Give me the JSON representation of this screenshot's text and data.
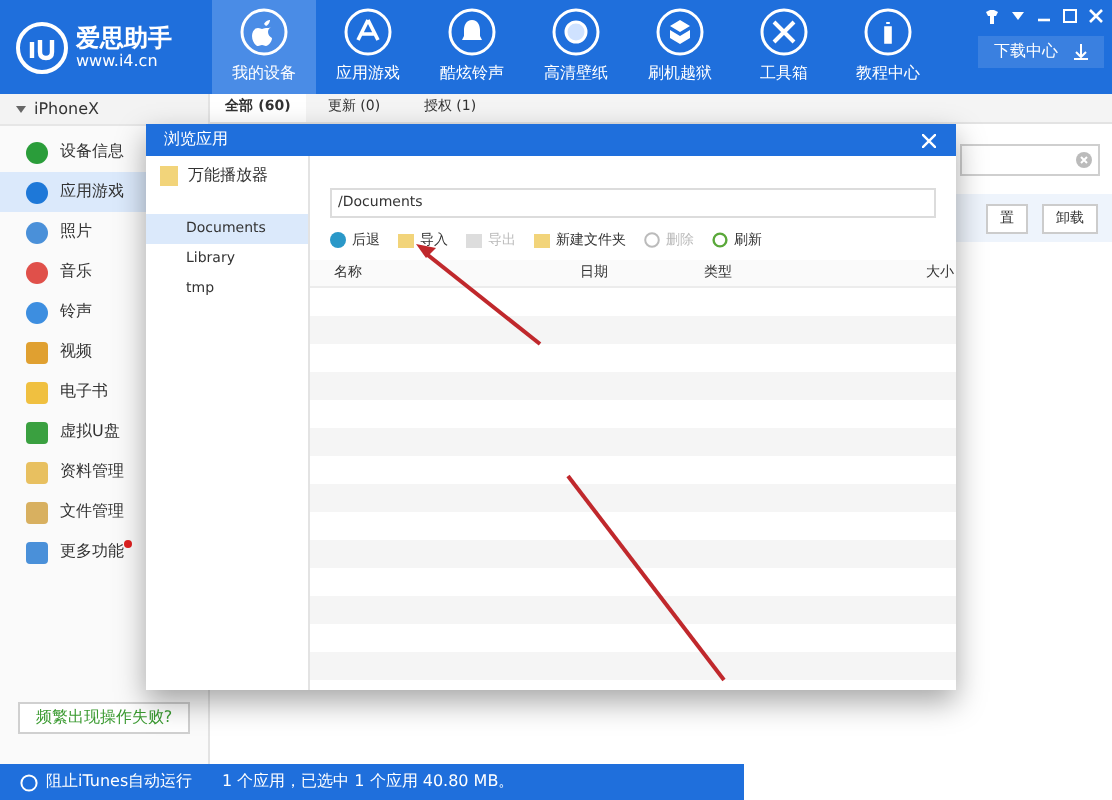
{
  "header": {
    "brand": "爱思助手",
    "url": "www.i4.cn",
    "download_button": "下载中心",
    "nav": [
      {
        "label": "我的设备",
        "selected": true
      },
      {
        "label": "应用游戏",
        "selected": false
      },
      {
        "label": "酷炫铃声",
        "selected": false
      },
      {
        "label": "高清壁纸",
        "selected": false
      },
      {
        "label": "刷机越狱",
        "selected": false
      },
      {
        "label": "工具箱",
        "selected": false
      },
      {
        "label": "教程中心",
        "selected": false
      }
    ]
  },
  "sidebar": {
    "device": "iPhoneX",
    "expanded": true,
    "items": [
      {
        "label": "设备信息",
        "selected": false,
        "badge": false
      },
      {
        "label": "应用游戏",
        "selected": true,
        "badge": false
      },
      {
        "label": "照片",
        "selected": false,
        "badge": false
      },
      {
        "label": "音乐",
        "selected": false,
        "badge": false
      },
      {
        "label": "铃声",
        "selected": false,
        "badge": false
      },
      {
        "label": "视频",
        "selected": false,
        "badge": false
      },
      {
        "label": "电子书",
        "selected": false,
        "badge": false
      },
      {
        "label": "虚拟U盘",
        "selected": false,
        "badge": false
      },
      {
        "label": "资料管理",
        "selected": false,
        "badge": false
      },
      {
        "label": "文件管理",
        "selected": false,
        "badge": false
      },
      {
        "label": "更多功能",
        "selected": false,
        "badge": true
      }
    ],
    "help_button": "频繁出现操作失败?"
  },
  "tabs": [
    {
      "label": "全部 (60)",
      "selected": true
    },
    {
      "label": "更新 (0)",
      "selected": false
    },
    {
      "label": "授权 (1)",
      "selected": false
    }
  ],
  "main_buttons": [
    "置",
    "卸载"
  ],
  "dialog": {
    "title": "浏览应用",
    "app": "万能播放器",
    "folders": [
      {
        "label": "Documents",
        "selected": true
      },
      {
        "label": "Library",
        "selected": false
      },
      {
        "label": "tmp",
        "selected": false
      }
    ],
    "path": "/Documents",
    "toolbar": [
      {
        "label": "后退",
        "disabled": false
      },
      {
        "label": "导入",
        "disabled": false
      },
      {
        "label": "导出",
        "disabled": true
      },
      {
        "label": "新建文件夹",
        "disabled": false
      },
      {
        "label": "删除",
        "disabled": true
      },
      {
        "label": "刷新",
        "disabled": false
      }
    ],
    "columns": [
      "名称",
      "日期",
      "类型",
      "大小"
    ]
  },
  "status_bar": {
    "itunes": "阻止iTunes自动运行",
    "summary": "1 个应用，已选中 1 个应用 40.80 MB。"
  }
}
